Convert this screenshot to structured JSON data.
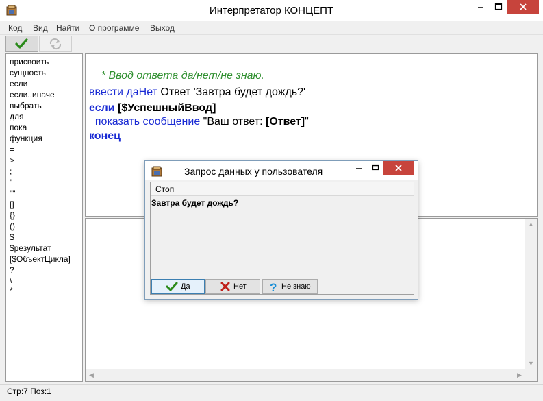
{
  "window": {
    "title": "Интерпретатор КОНЦЕПТ"
  },
  "menu": [
    "Код",
    "Вид",
    "Найти",
    "О программе",
    "Выход"
  ],
  "toolbar": {
    "run_icon": "checkmark-icon",
    "refresh_icon": "refresh-icon"
  },
  "sidebar": {
    "items": [
      "присвоить",
      "сущность",
      "если",
      "если..иначе",
      "выбрать",
      "для",
      "пока",
      "функция",
      "=",
      ">",
      ";",
      "\"",
      "\"\"",
      "[]",
      "{}",
      "()",
      "$",
      "$результат",
      "[$ОбъектЦикла]",
      "?",
      "\\",
      "*"
    ]
  },
  "editor": {
    "comment": "* Ввод ответа да/нет/не знаю.",
    "line2_kw": "ввести даНет",
    "line2_rest": " Ответ 'Завтра будет дождь?'",
    "line3_kw": "если",
    "line3_rest": " [$УспешныйВвод]",
    "line4_indent": "  ",
    "line4_kw": "показать сообщение",
    "line4_text": " \"Ваш ответ: ",
    "line4_bold": "[Ответ]",
    "line4_end": "\"",
    "line5_kw": "конец"
  },
  "status": {
    "text": "Стр:7 Поз:1"
  },
  "dialog": {
    "title": "Запрос данных у пользователя",
    "menu_label": "Стоп",
    "question": "Завтра будет дождь?",
    "buttons": {
      "yes": "Да",
      "no": "Нет",
      "dont_know": "Не знаю"
    }
  },
  "colors": {
    "keyword": "#1a2bd4",
    "comment": "#2f8f2f",
    "close_button": "#c7443c"
  }
}
